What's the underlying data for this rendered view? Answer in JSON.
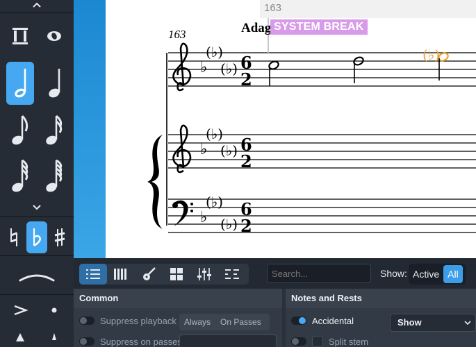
{
  "score": {
    "bar_number_readout": "163",
    "system_break_label": "SYSTEM BREAK",
    "tempo_text": "Adagio",
    "measure_number": "163"
  },
  "toolbox": {
    "icons": [
      "chevron-up-icon",
      "tuplet-bracket-icon",
      "whole-note-icon",
      "half-note-icon",
      "quarter-note-icon",
      "eighth-note-icon",
      "sixteenth-note-icon",
      "thirty-second-note-icon",
      "sixty-fourth-note-icon",
      "chevron-down-icon",
      "natural-icon",
      "flat-icon",
      "sharp-icon",
      "slur-icon",
      "accent-icon",
      "staccato-icon",
      "marcato-icon"
    ],
    "active_duration": "half-note",
    "active_accidental": "flat"
  },
  "properties": {
    "tabs": [
      "list",
      "keyboard",
      "guitar",
      "grid",
      "mixer",
      "lines"
    ],
    "active_tab": "list",
    "search_placeholder": "Search...",
    "show_label": "Show:",
    "show_options": [
      "Active",
      "All"
    ],
    "show_selected": "All",
    "common": {
      "title": "Common",
      "suppress_playback": "Suppress playback",
      "suppress_on_passes": "Suppress on passes",
      "always": "Always",
      "on_passes": "On Passes"
    },
    "notes_and_rests": {
      "title": "Notes and Rests",
      "accidental": "Accidental",
      "accidental_value": "Show",
      "split_stem": "Split stem"
    }
  },
  "colors": {
    "accent": "#46a8f0",
    "system_break": "#d79be9",
    "selected_note": "#f0a030"
  }
}
